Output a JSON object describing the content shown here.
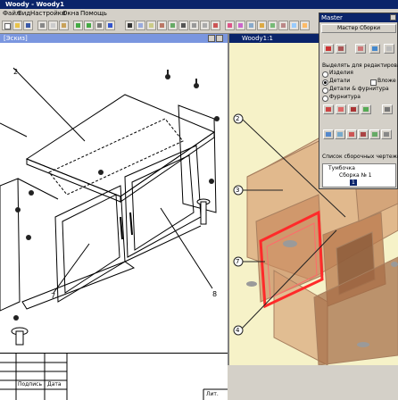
{
  "app": {
    "title": "Woody - Woody1"
  },
  "menu": {
    "items": [
      "Файл",
      "Вид",
      "Настройки",
      "Окна",
      "Помощь"
    ]
  },
  "left_window": {
    "caption": "[Эскиз]"
  },
  "right_window": {
    "caption": "Woody1:1"
  },
  "drawing": {
    "callouts": [
      "2",
      "7",
      "8"
    ],
    "table": {
      "labels": [
        "Подпись",
        "Дата",
        "Лит."
      ]
    }
  },
  "model_view": {
    "callouts": [
      "2",
      "3",
      "7",
      "4"
    ]
  },
  "master": {
    "caption": "Master",
    "tab": "Мастер Сборки",
    "select_label": "Выделять для редактирования:",
    "radios": [
      "Изделия",
      "Детали",
      "Детали & фурнитура",
      "Фурнитура"
    ],
    "radio_selected_index": 1,
    "checkbox_label": "Вложе",
    "list_label": "Список сборочных чертежей",
    "tree": [
      "Тумбочка",
      "Сборка № 1",
      "1"
    ]
  }
}
